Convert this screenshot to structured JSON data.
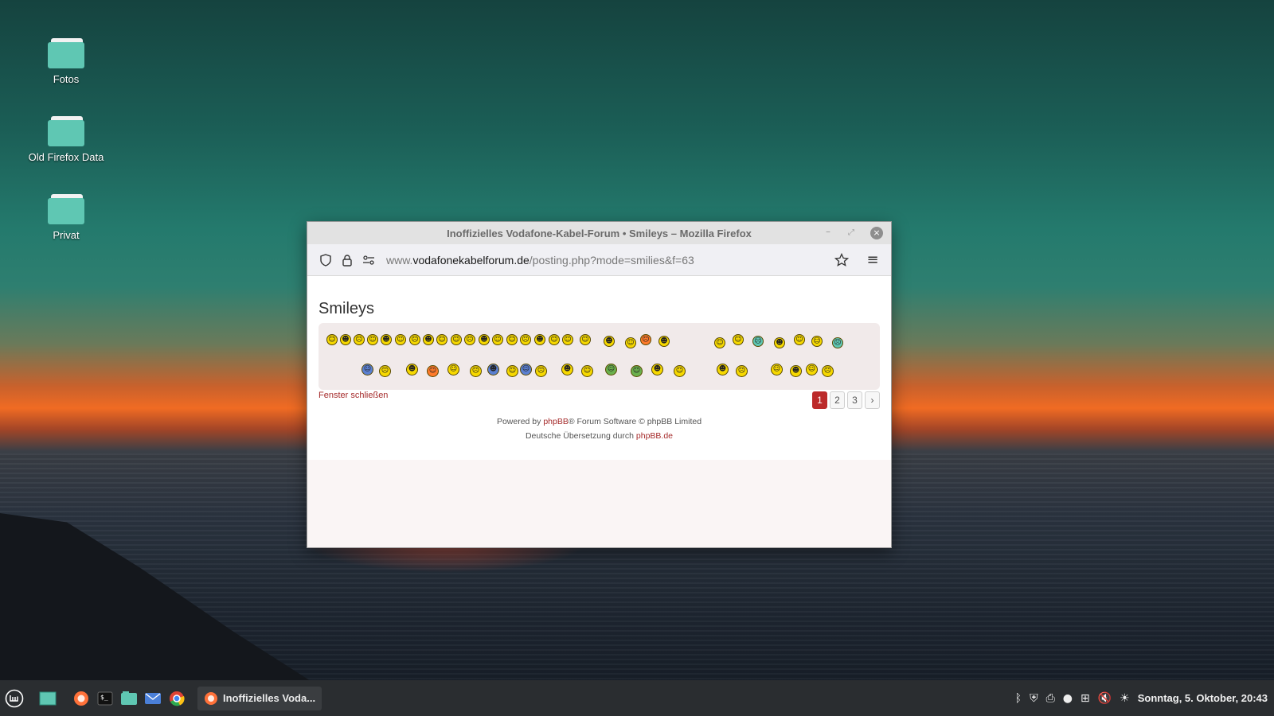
{
  "desktop": {
    "icons": [
      {
        "label": "Fotos"
      },
      {
        "label": "Old Firefox Data"
      },
      {
        "label": "Privat"
      }
    ]
  },
  "window": {
    "title": "Inoffizielles Vodafone-Kabel-Forum • Smileys – Mozilla Firefox",
    "url_prefix": "www.",
    "url_domain": "vodafonekabelforum.de",
    "url_path": "/posting.php?mode=smilies&f=63"
  },
  "page": {
    "heading": "Smileys",
    "close_link": "Fenster schließen",
    "pagination": [
      "1",
      "2",
      "3"
    ],
    "active_page": "1",
    "footer": {
      "powered_prefix": "Powered by ",
      "powered_link": "phpBB",
      "powered_suffix": "® Forum Software © phpBB Limited",
      "translation_prefix": "Deutsche Übersetzung durch ",
      "translation_link": "phpBB.de"
    }
  },
  "taskbar": {
    "task_label": "Inoffizielles Voda...",
    "clock": "Sonntag, 5. Oktober, 20:43"
  },
  "colors": {
    "accent_link": "#a52a2a",
    "active_page": "#bc2a2a",
    "folder": "#5fc7b3"
  }
}
